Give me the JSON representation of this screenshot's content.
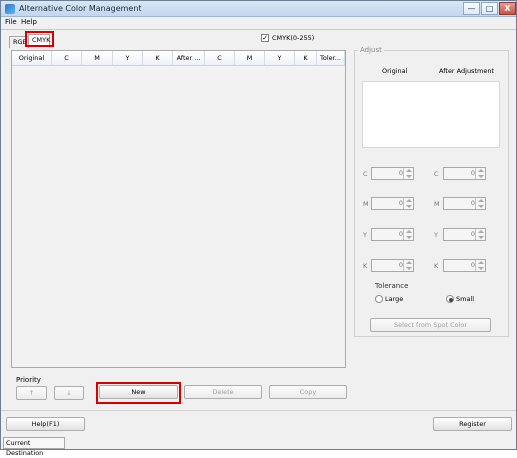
{
  "window": {
    "title": "Alternative Color Management",
    "controls": {
      "minimize": "—",
      "maximize": "□",
      "close": "X"
    }
  },
  "menu": [
    "File",
    "Help"
  ],
  "tabs": [
    "RGB",
    "CMYK"
  ],
  "checkbox": {
    "label": "CMYK(0-255)",
    "mark": "✓"
  },
  "grid_columns": [
    "Original",
    "C",
    "M",
    "Y",
    "K",
    "After ...",
    "C",
    "M",
    "Y",
    "K",
    "Toler..."
  ],
  "priority": {
    "label": "Priority",
    "up": "↑",
    "down": "↓"
  },
  "buttons": {
    "new": "New",
    "delete": "Delete",
    "copy": "Copy",
    "help": "Help(F1)",
    "register": "Register"
  },
  "adjust": {
    "title": "Adjust",
    "original": "Original",
    "after": "After Adjustment",
    "left": [
      {
        "label": "C",
        "value": "0"
      },
      {
        "label": "M",
        "value": "0"
      },
      {
        "label": "Y",
        "value": "0"
      },
      {
        "label": "K",
        "value": "0"
      }
    ],
    "right": [
      {
        "label": "C",
        "value": "0"
      },
      {
        "label": "M",
        "value": "0"
      },
      {
        "label": "Y",
        "value": "0"
      },
      {
        "label": "K",
        "value": "0"
      }
    ],
    "tolerance": {
      "title": "Tolerance",
      "large": "Large",
      "small": "Small",
      "selected": "Small"
    },
    "spot_button": "Select from Spot Color"
  },
  "status": "Current Destination"
}
